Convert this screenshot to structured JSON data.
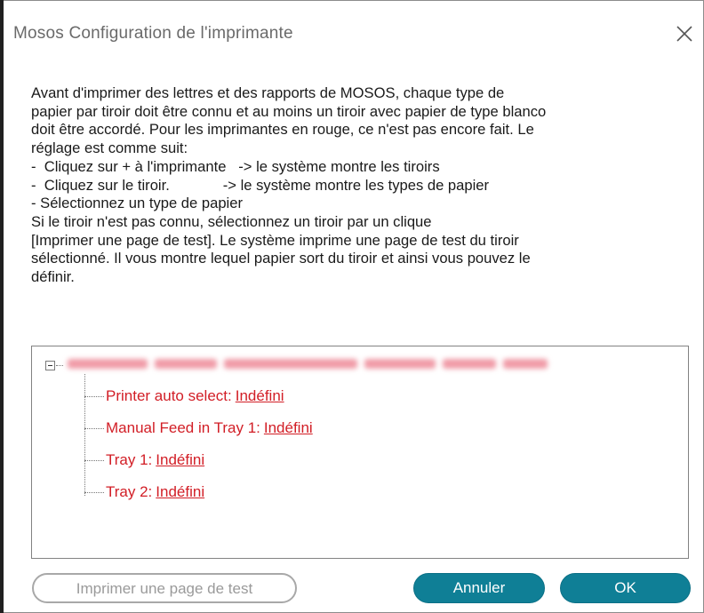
{
  "window": {
    "title": "Mosos Configuration de l'imprimante"
  },
  "instructions": [
    "Avant d'imprimer des lettres et des rapports de MOSOS, chaque type de",
    "papier par tiroir doit être connu et au moins un tiroir avec papier de type blanco",
    "doit être accordé. Pour les imprimantes en rouge, ce n'est pas encore fait. Le",
    "réglage est comme suit:",
    "-  Cliquez sur + à l'imprimante   -> le système montre les tiroirs",
    "-  Cliquez sur le tiroir.             -> le système montre les types de papier",
    "-  Sélectionnez un type de papier",
    "Si le tiroir n'est pas connu, sélectionnez un tiroir par un clique",
    "[Imprimer une page de test]. Le système imprime une page de test du tiroir",
    "sélectionné. Il vous montre lequel papier sort du tiroir et ainsi vous pouvez le",
    "définir."
  ],
  "tree": {
    "root_label_note": "printer name (blurred)",
    "items": [
      {
        "label": "Printer auto select:",
        "value": "Indéfini"
      },
      {
        "label": "Manual Feed in Tray 1:",
        "value": "Indéfini"
      },
      {
        "label": "Tray 1:",
        "value": "Indéfini"
      },
      {
        "label": "Tray 2:",
        "value": "Indéfini"
      }
    ]
  },
  "buttons": {
    "test": "Imprimer une page de test",
    "cancel": "Annuler",
    "ok": "OK"
  },
  "colors": {
    "accent": "#0f7f96",
    "undefined_text": "#d21e26",
    "blurred_root": "#f09aa6"
  }
}
